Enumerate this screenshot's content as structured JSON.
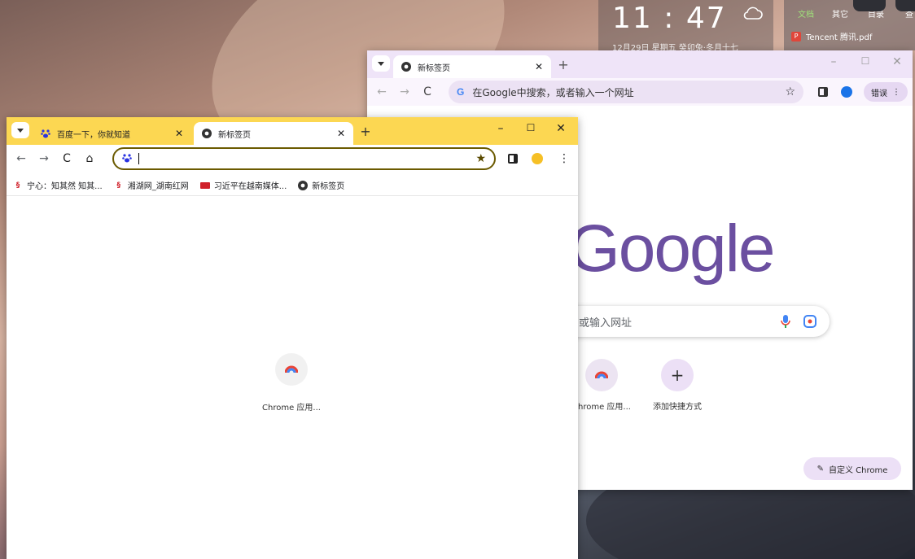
{
  "desktop": {
    "clock": "11 : 47",
    "date_line": "12月29日  星期五  癸卯兔·冬月十七",
    "notes_tabs": [
      "文档",
      "其它",
      "目录",
      "查"
    ],
    "notes_file": "Tencent 腾讯.pdf"
  },
  "back_window": {
    "tab_title": "新标签页",
    "omnibox_placeholder": "在Google中搜索，或者输入一个网址",
    "profile_label": "错误",
    "logo_text": "Google",
    "search_placeholder": "或输入网址",
    "shortcuts": [
      {
        "label": "Chrome 应用..."
      },
      {
        "label": "添加快捷方式"
      }
    ],
    "customize_label": "自定义 Chrome"
  },
  "front_window": {
    "tabs": [
      {
        "title": "百度一下，你就知道"
      },
      {
        "title": "新标签页"
      }
    ],
    "omnibox_value": "",
    "bookmarks": [
      {
        "label": "宁心：知其然 知其..."
      },
      {
        "label": "湘湖网_湖南红网"
      },
      {
        "label": "习近平在越南媒体..."
      },
      {
        "label": "新标签页"
      }
    ],
    "shortcut_label": "Chrome 应用..."
  },
  "colors": {
    "front_tabbar": "#fcd752",
    "back_tabbar": "#efe4f8",
    "google_logo": "#6b4fa0"
  }
}
